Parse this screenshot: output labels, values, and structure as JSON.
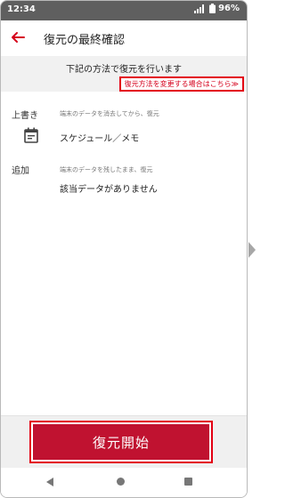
{
  "status_bar": {
    "time": "12:34",
    "battery": "96%"
  },
  "header": {
    "title": "復元の最終確認",
    "back_icon": "back-arrow-icon"
  },
  "banner": {
    "text": "下記の方法で復元を行います",
    "change_link": "復元方法を変更する場合はこちら≫"
  },
  "overwrite": {
    "label": "上書き",
    "description": "端末のデータを消去してから、復元",
    "item": "スケジュール／メモ",
    "item_icon": "calendar-icon"
  },
  "add": {
    "label": "追加",
    "description": "端末のデータを残したまま、復元",
    "item": "該当データがありません"
  },
  "footer": {
    "start_button": "復元開始"
  },
  "colors": {
    "accent": "#c01230",
    "highlight": "#e30013",
    "status_bar": "#5f5f5f"
  }
}
